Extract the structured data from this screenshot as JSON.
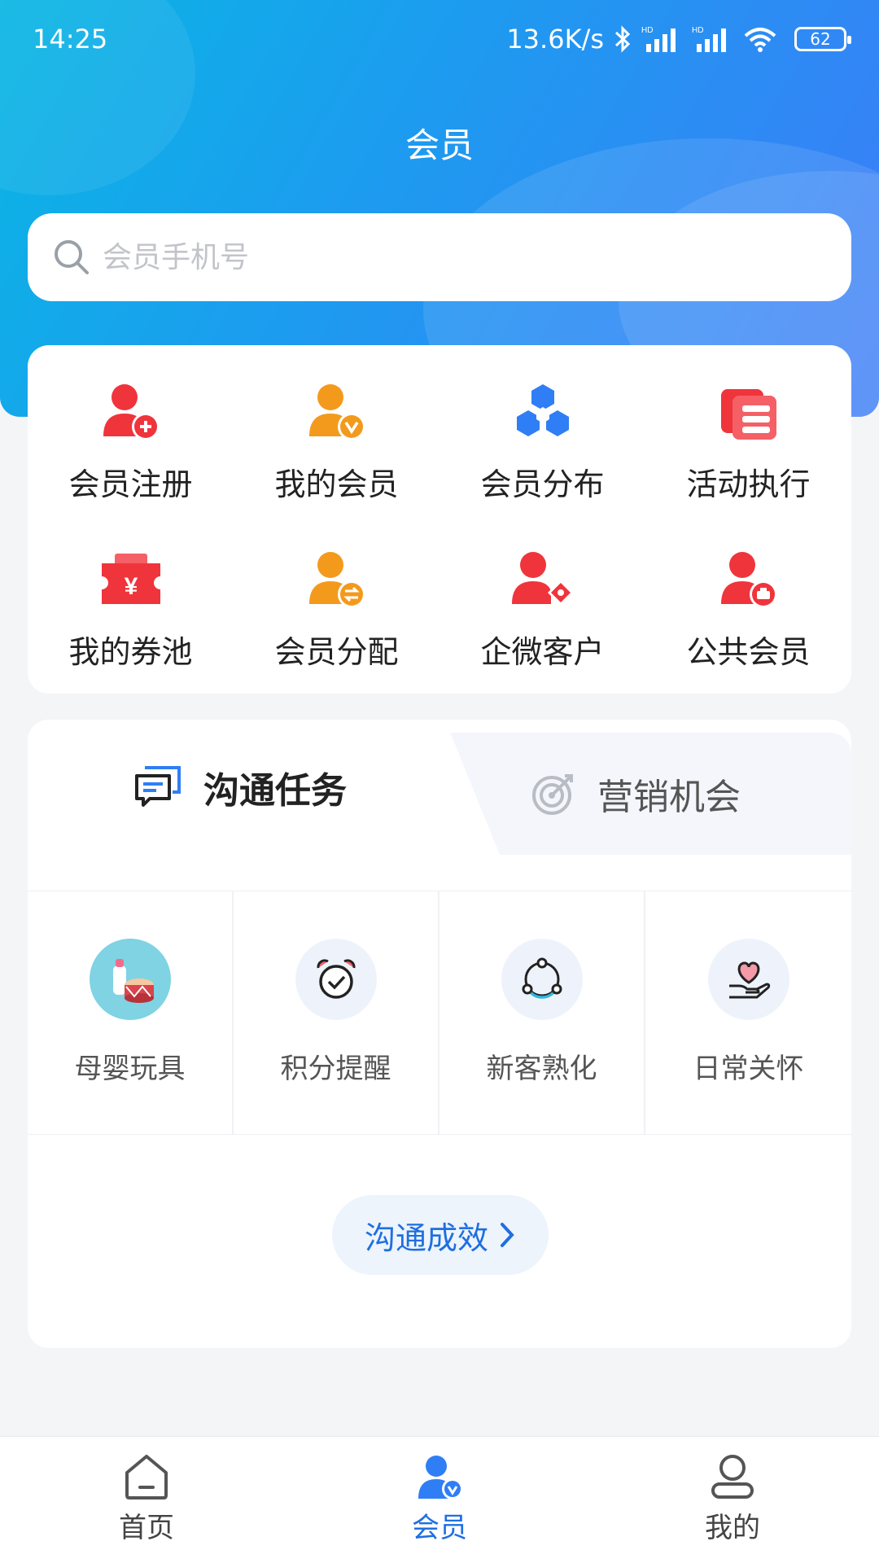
{
  "status_bar": {
    "time": "14:25",
    "speed": "13.6K/s",
    "battery": "62",
    "icons": [
      "bluetooth-icon",
      "signal-hd-icon",
      "signal-hd-icon",
      "wifi-icon",
      "battery-icon"
    ]
  },
  "header": {
    "title": "会员"
  },
  "search": {
    "placeholder": "会员手机号"
  },
  "quick_actions": [
    {
      "label": "会员注册",
      "icon": "member-register-icon"
    },
    {
      "label": "我的会员",
      "icon": "my-members-icon"
    },
    {
      "label": "会员分布",
      "icon": "member-distribution-icon"
    },
    {
      "label": "活动执行",
      "icon": "activity-execution-icon"
    },
    {
      "label": "我的券池",
      "icon": "coupon-pool-icon"
    },
    {
      "label": "会员分配",
      "icon": "member-allocation-icon"
    },
    {
      "label": "企微客户",
      "icon": "wecom-customer-icon"
    },
    {
      "label": "公共会员",
      "icon": "public-member-icon"
    }
  ],
  "tabs": [
    {
      "label": "沟通任务",
      "icon": "chat-task-icon",
      "active": true
    },
    {
      "label": "营销机会",
      "icon": "target-icon",
      "active": false
    }
  ],
  "tasks": [
    {
      "label": "母婴玩具",
      "icon": "baby-toys-icon"
    },
    {
      "label": "积分提醒",
      "icon": "alarm-clock-icon"
    },
    {
      "label": "新客熟化",
      "icon": "cycle-nodes-icon"
    },
    {
      "label": "日常关怀",
      "icon": "heart-hand-icon"
    }
  ],
  "effect_button": {
    "label": "沟通成效"
  },
  "bottom_nav": [
    {
      "label": "首页",
      "icon": "home-icon",
      "active": false
    },
    {
      "label": "会员",
      "icon": "member-icon",
      "active": true
    },
    {
      "label": "我的",
      "icon": "profile-icon",
      "active": false
    }
  ],
  "colors": {
    "primary": "#1f6fe0",
    "red": "#f0343b",
    "orange": "#f39a1d",
    "blue_icon": "#2f7ef5",
    "header_start": "#09b6e4",
    "header_end": "#3d7bf8"
  }
}
